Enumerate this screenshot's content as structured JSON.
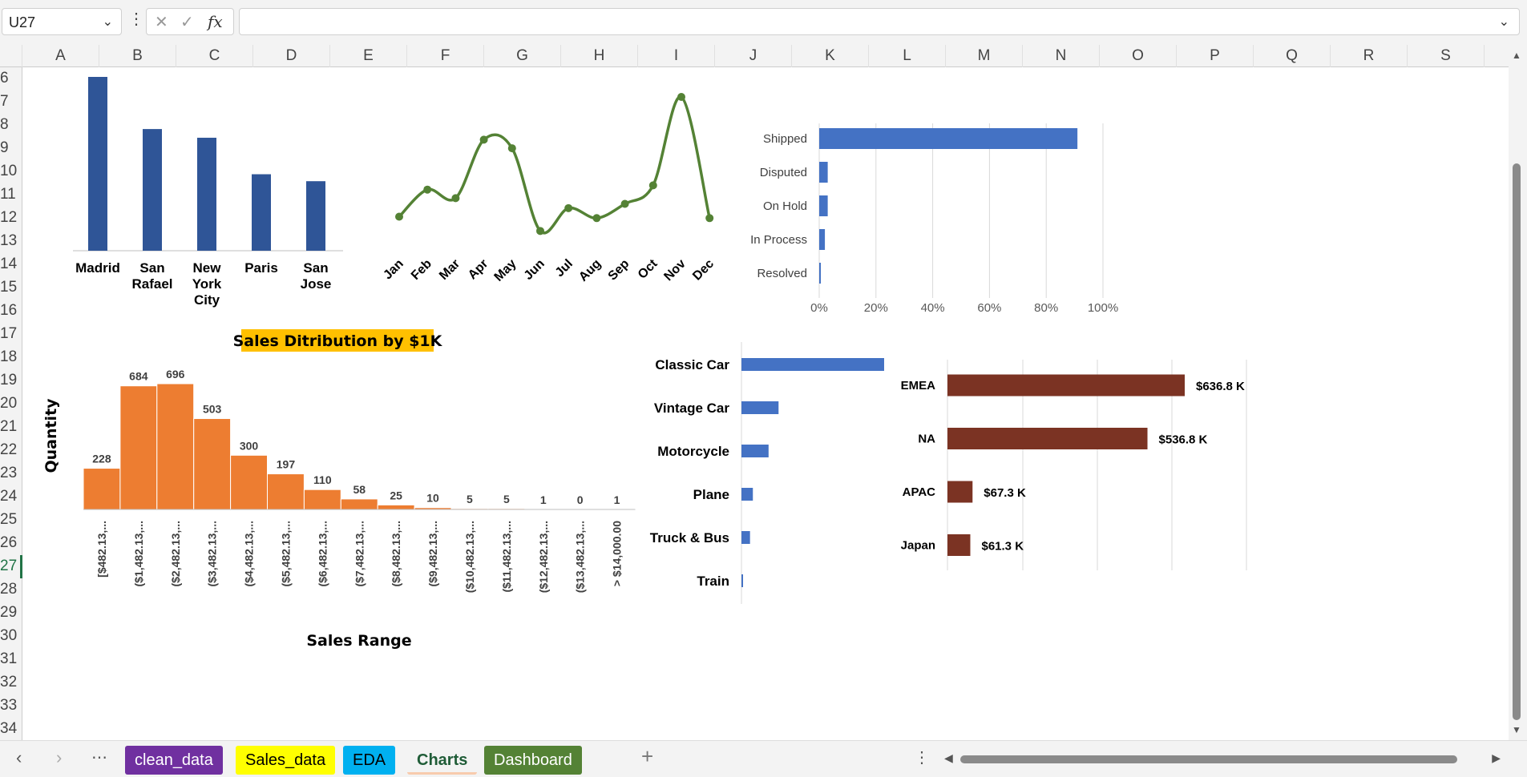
{
  "formula_bar": {
    "cell_ref": "U27",
    "cancel_icon": "✕",
    "enter_icon": "✓",
    "fx_label": "fx",
    "formula": ""
  },
  "columns": [
    "A",
    "B",
    "C",
    "D",
    "E",
    "F",
    "G",
    "H",
    "I",
    "J",
    "K",
    "L",
    "M",
    "N",
    "O",
    "P",
    "Q",
    "R",
    "S"
  ],
  "rows": [
    "6",
    "7",
    "8",
    "9",
    "10",
    "11",
    "12",
    "13",
    "14",
    "15",
    "16",
    "17",
    "18",
    "19",
    "20",
    "21",
    "22",
    "23",
    "24",
    "25",
    "26",
    "27",
    "28",
    "29",
    "30",
    "31",
    "32",
    "33",
    "34"
  ],
  "selected_row": "27",
  "sheet_tabs": [
    {
      "label": "clean_data",
      "bg": "#7030a0",
      "color": "#ffffff"
    },
    {
      "label": "Sales_data",
      "bg": "#ffff00",
      "color": "#000000"
    },
    {
      "label": "EDA",
      "bg": "#00b0f0",
      "color": "#000000"
    },
    {
      "label": "Charts",
      "bg": "#f8cbad",
      "color": "#000000",
      "active": true
    },
    {
      "label": "Dashboard",
      "bg": "#548235",
      "color": "#ffffff"
    }
  ],
  "chart_data": [
    {
      "type": "bar",
      "categories": [
        "Madrid",
        "San Rafael",
        "New York City",
        "Paris",
        "San Jose"
      ],
      "values": [
        1.0,
        0.7,
        0.65,
        0.44,
        0.4
      ],
      "color": "#2f5597"
    },
    {
      "type": "line",
      "categories": [
        "Jan",
        "Feb",
        "Mar",
        "Apr",
        "May",
        "Jun",
        "Jul",
        "Aug",
        "Sep",
        "Oct",
        "Nov",
        "Dec"
      ],
      "values": [
        0.16,
        0.35,
        0.29,
        0.7,
        0.64,
        0.06,
        0.22,
        0.15,
        0.25,
        0.38,
        1.0,
        0.15
      ],
      "color": "#548235"
    },
    {
      "type": "bar",
      "orientation": "horizontal",
      "categories": [
        "Shipped",
        "Disputed",
        "On Hold",
        "In Process",
        "Resolved"
      ],
      "values": [
        91,
        3,
        3,
        2,
        0.5
      ],
      "ticks": [
        "0%",
        "20%",
        "40%",
        "60%",
        "80%",
        "100%"
      ],
      "xlim": [
        0,
        100
      ],
      "color": "#4472c4"
    },
    {
      "type": "bar",
      "title": "Sales Ditribution by $1K",
      "xlabel": "Sales Range",
      "ylabel": "Quantity",
      "categories": [
        "[$482.13,...",
        "($1,482.13,...",
        "($2,482.13,...",
        "($3,482.13,...",
        "($4,482.13,...",
        "($5,482.13,...",
        "($6,482.13,...",
        "($7,482.13,...",
        "($8,482.13,...",
        "($9,482.13,...",
        "($10,482.13,...",
        "($11,482.13,...",
        "($12,482.13,...",
        "($13,482.13,...",
        "> $14,000.00"
      ],
      "values": [
        228,
        684,
        696,
        503,
        300,
        197,
        110,
        58,
        25,
        10,
        5,
        5,
        1,
        0,
        1
      ],
      "color": "#ed7d31"
    },
    {
      "type": "bar",
      "orientation": "horizontal",
      "categories": [
        "Classic Car",
        "Vintage Car",
        "Motorcycle",
        "Plane",
        "Truck & Bus",
        "Train"
      ],
      "values": [
        1.0,
        0.26,
        0.19,
        0.08,
        0.06,
        0.01
      ],
      "color": "#4472c4"
    },
    {
      "type": "bar",
      "orientation": "horizontal",
      "categories": [
        "EMEA",
        "NA",
        "APAC",
        "Japan"
      ],
      "values": [
        636.8,
        536.8,
        67.3,
        61.3
      ],
      "labels": [
        "$636.8 K",
        "$536.8 K",
        "$67.3 K",
        "$61.3 K"
      ],
      "color": "#7b3323"
    }
  ]
}
